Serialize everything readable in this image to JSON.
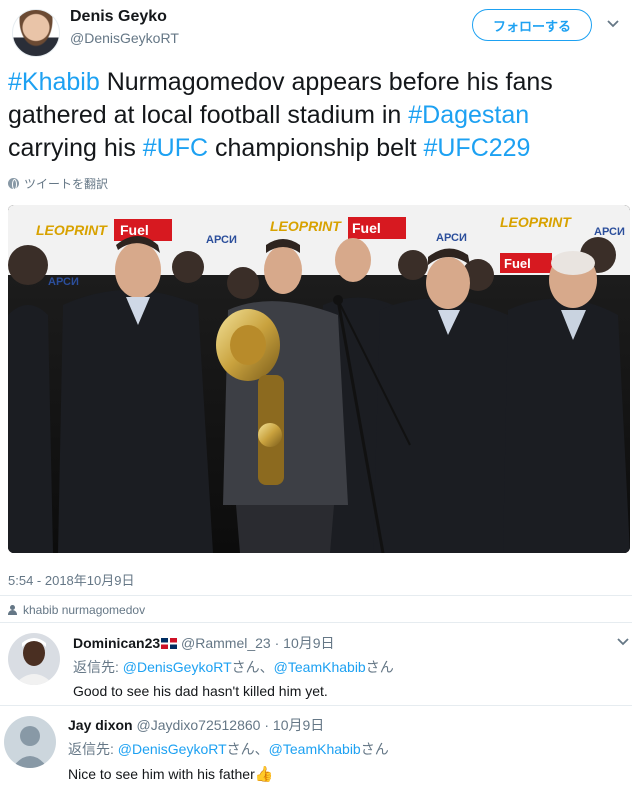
{
  "tweet": {
    "author_name": "Denis Geyko",
    "author_handle": "@DenisGeykoRT",
    "follow_label": "フォローする",
    "text_segments": [
      {
        "text": "#Khabib",
        "hashtag": true
      },
      {
        "text": " Nurmagomedov appears before his fans gathered at local football stadium in ",
        "hashtag": false
      },
      {
        "text": "#Dagestan",
        "hashtag": true
      },
      {
        "text": " carrying his ",
        "hashtag": false
      },
      {
        "text": "#UFC",
        "hashtag": true
      },
      {
        "text": " championship belt ",
        "hashtag": false
      },
      {
        "text": "#UFC229",
        "hashtag": true
      }
    ],
    "translate_label": "ツイートを翻訳",
    "timestamp": "5:54 - 2018年10月9日",
    "tagged_user": "khabib nurmagomedov"
  },
  "photo": {
    "banner_texts": [
      "LEOPRINT",
      "Fuel",
      "АРСИ",
      "LEOPRINT",
      "Fuel",
      "АРСИ",
      "LEOPRINT",
      "АРСИ",
      "Fuel"
    ]
  },
  "replies": [
    {
      "name": "Dominican23",
      "handle": "@Rammel_23",
      "date": "10月9日",
      "reply_prefix": "返信先: ",
      "mention1": "@DenisGeykoRT",
      "mid": "さん、",
      "mention2": "@TeamKhabib",
      "suffix": "さん",
      "body": "Good to see his dad hasn't killed him yet."
    },
    {
      "name": "Jay dixon",
      "handle": "@Jaydixo72512860",
      "date": "10月9日",
      "reply_prefix": "返信先: ",
      "mention1": "@DenisGeykoRT",
      "mid": "さん、",
      "mention2": "@TeamKhabib",
      "suffix": "さん",
      "body": "Nice to see him with his father",
      "emoji": "👍"
    }
  ],
  "colors": {
    "link": "#1da1f2",
    "secondary_text": "#657786",
    "primary_text": "#14171a"
  }
}
